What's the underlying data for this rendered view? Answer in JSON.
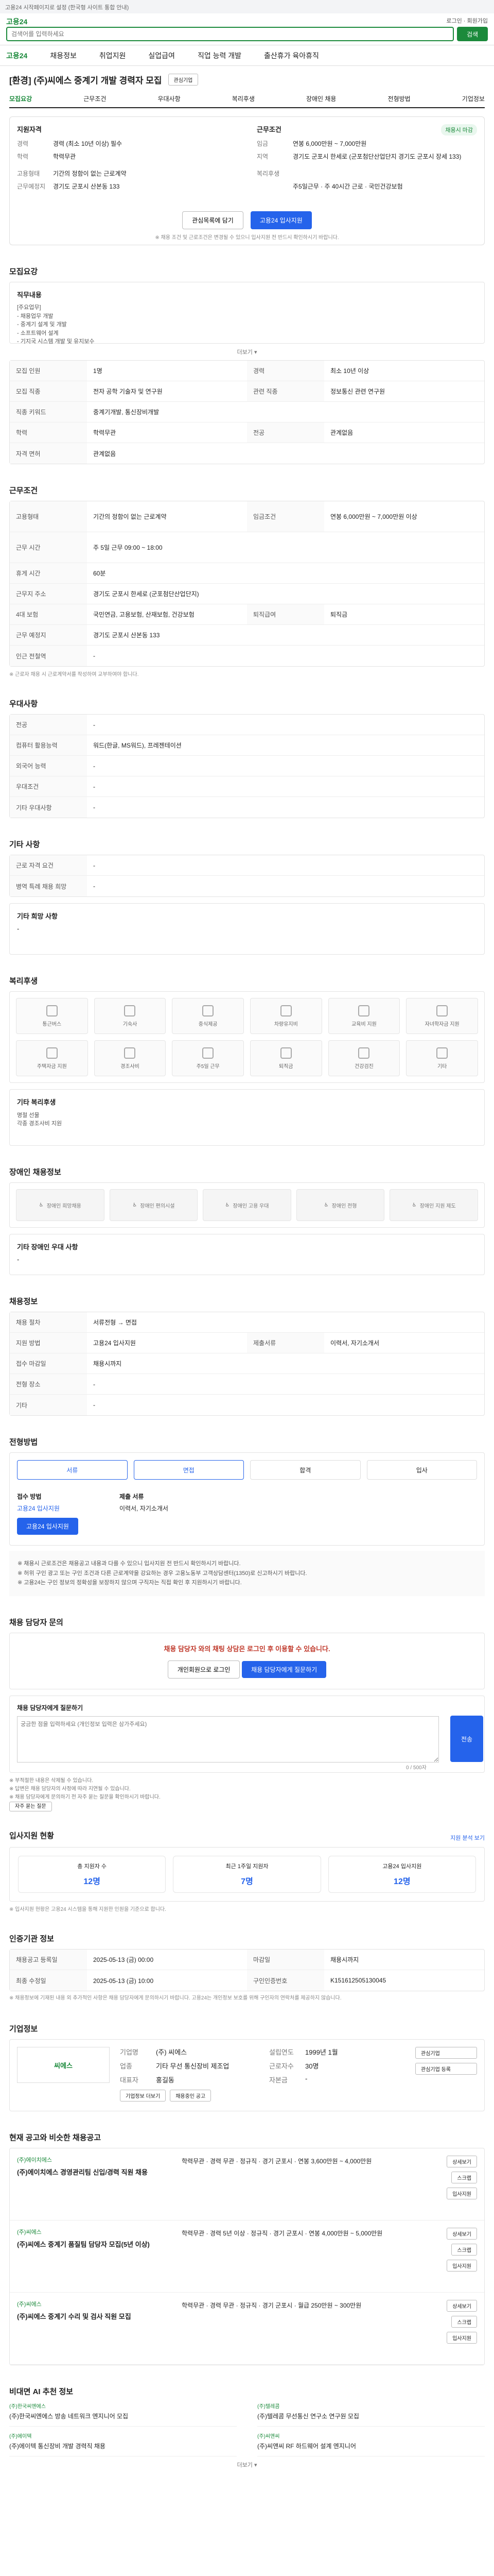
{
  "topbar": {
    "text": "고용24 시작페이지로 설정 (한국형 사이트 통합 안내)"
  },
  "header": {
    "logo": "고용24",
    "search_placeholder": "검색어를 입력하세요",
    "search_btn": "검색",
    "right_links": "로그인 · 회원가입"
  },
  "nav": [
    "고용24",
    "채용정보",
    "취업지원",
    "실업급여",
    "직업 능력 개발",
    "출산휴가 육아휴직"
  ],
  "title": "[환경] (주)씨에스 중계기 개발 경력자 모집",
  "interest_btn": "관심기업",
  "tabs": [
    "모집요강",
    "근무조건",
    "우대사항",
    "복리후생",
    "장애인 채용",
    "전형방법",
    "기업정보"
  ],
  "summary": {
    "left_title": "지원자격",
    "left": [
      {
        "k": "경력",
        "v": "경력 (최소 10년 이상) 필수"
      },
      {
        "k": "학력",
        "v": "학력무관"
      },
      {
        "k": "",
        "v": ""
      },
      {
        "k": "고용형태",
        "v": "기간의 정함이 없는 근로계약"
      },
      {
        "k": "근무예정지",
        "v": "경기도 군포시 산본동 133"
      }
    ],
    "right_title": "근무조건",
    "right": [
      {
        "k": "임금",
        "v": "연봉 6,000만원 ~ 7,000만원"
      },
      {
        "k": "지역",
        "v": "경기도 군포시 한세로 (군포첨단산업단지 경기도 군포시 장세 133)"
      },
      {
        "k": "",
        "v": ""
      },
      {
        "k": "복리후생",
        "v": ""
      },
      {
        "k": "",
        "v": "주5일근무 · 주 40시간 근로 · 국민건강보험"
      }
    ],
    "closed_badge": "채용시 마감",
    "btn_interest": "관심목록에 담기",
    "btn_apply": "고용24 입사지원",
    "note": "※ 채용 조건 및 근로조건은 변경될 수 있으니 입사지원 전 반드시 확인하시기 바랍니다."
  },
  "recruit": {
    "title": "모집요강",
    "duty_label": "직무내용",
    "duty_text": "[주요업무]\n- 채용업무 개발\n- 중계기 설계 및 개발\n- 소프트웨어 설계\n- 기지국 시스템 개발 및 유지보수",
    "more_btn": "더보기 ▾",
    "rows": [
      {
        "k": "모집 인원",
        "v": "1명",
        "k2": "경력",
        "v2": "최소 10년 이상"
      },
      {
        "k": "모집 직종",
        "v": "전자 공학 기술자 및 연구원",
        "k2": "관련 직종",
        "v2": "정보통신 관련 연구원"
      },
      {
        "k": "직종 키워드",
        "v": "중계기개발, 통신장비개발"
      },
      {
        "k": "학력",
        "v": "학력무관",
        "k2": "전공",
        "v2": "관계없음"
      },
      {
        "k": "자격 면허",
        "v": "관계없음"
      }
    ]
  },
  "conditions": {
    "title": "근무조건",
    "rows": [
      {
        "k": "고용형태",
        "v": "기간의 정함이 없는 근로계약",
        "k2": "임금조건",
        "v2": "연봉 6,000만원 ~ 7,000만원 이상"
      },
      {
        "k": "근무 시간",
        "v": "주 5일 근무 09:00 ~ 18:00"
      },
      {
        "k": "휴게 시간",
        "v": "60분"
      },
      {
        "k": "근무지 주소",
        "v": "경기도 군포시 한세로 (군포첨단산업단지)"
      },
      {
        "k": "4대 보험",
        "v": "국민연금, 고용보험, 산재보험, 건강보험",
        "k2": "퇴직급여",
        "v2": "퇴직금"
      },
      {
        "k": "근무 예정지",
        "v": "경기도 군포시 산본동 133"
      },
      {
        "k": "인근 전철역",
        "v": "-"
      }
    ],
    "note": "※ 근로자 채용 시 근로계약서를 작성하여 교부하여야 합니다."
  },
  "prefer": {
    "title": "우대사항",
    "rows": [
      {
        "k": "전공",
        "v": "-"
      },
      {
        "k": "컴퓨터 활용능력",
        "v": "워드(한글, MS워드), 프레젠테이션"
      },
      {
        "k": "외국어 능력",
        "v": "-"
      },
      {
        "k": "우대조건",
        "v": "-"
      },
      {
        "k": "기타 우대사항",
        "v": "-"
      }
    ]
  },
  "vacancy": {
    "title": "기타 사항",
    "rows": [
      {
        "k": "근로 자격 요건",
        "v": "-"
      },
      {
        "k": "병역 특례 채용 희망",
        "v": "-"
      }
    ],
    "extra_label": "기타 희망 사항",
    "extra_value": "-"
  },
  "welfare": {
    "title": "복리후생",
    "items": [
      "통근버스",
      "기숙사",
      "중식제공",
      "차량유지비",
      "교육비 지원",
      "자녀학자금 지원",
      "주택자금 지원",
      "경조사비",
      "주5일 근무",
      "퇴직금",
      "건강검진",
      "기타"
    ],
    "etc_label": "기타 복리후생",
    "etc_text": "명절 선물\n각종 경조사비 지원\n"
  },
  "disability": {
    "title": "장애인 채용정보",
    "items": [
      "장애인 희망채용",
      "장애인 편의시설",
      "장애인 고용 우대",
      "장애인 전형",
      "장애인 지원 제도"
    ],
    "note_label": "기타 장애인 우대 사항",
    "note_value": "-"
  },
  "consult": {
    "title": "채용정보",
    "rows": [
      {
        "k": "채용 절차",
        "v": "서류전형 → 면접",
        "k2": "",
        "v2": ""
      },
      {
        "k": "지원 방법",
        "v": "고용24 입사지원",
        "k2": "제출서류",
        "v2": "이력서, 자기소개서"
      },
      {
        "k": "접수 마감일",
        "v": "채용시까지",
        "k2": "",
        "v2": ""
      },
      {
        "k": "전형 장소",
        "v": "-",
        "k2": "",
        "v2": ""
      },
      {
        "k": "기타",
        "v": "-",
        "k2": "",
        "v2": ""
      }
    ]
  },
  "process": {
    "title": "전형방법",
    "steps": [
      "서류",
      "면접",
      "합격",
      "입사"
    ],
    "apply_label": "접수 방법",
    "apply_value": "고용24 입사지원",
    "btn_apply": "고용24 입사지원",
    "docs_label": "제출 서류",
    "docs_value": "이력서, 자기소개서",
    "warn": "※ 채용시 근로조건은 채용공고 내용과 다를 수 있으니 입사지원 전 반드시 확인하시기 바랍니다.\n※ 허위 구인 광고 또는 구인 조건과 다른 근로계약을 강요하는 경우 고용노동부 고객상담센터(1350)로 신고하시기 바랍니다.\n※ 고용24는 구인 정보의 정확성을 보장하지 않으며 구직자는 직접 확인 후 지원하시기 바랍니다."
  },
  "qna": {
    "title": "채용 담당자 문의",
    "notice": "채용 담당자 와의 채팅 상담은 로그인 후 이용할 수 있습니다.",
    "btn_login": "개인회원으로 로그인",
    "btn_ask": "채용 담당자에게 질문하기",
    "input_label": "채용 담당자에게 질문하기",
    "placeholder": "궁금한 점을 입력하세요 (개인정보 입력은 삼가주세요)",
    "count": "0 / 500자",
    "btn_send": "전송",
    "notes": "※ 부적절한 내용은 삭제될 수 있습니다.\n※ 답변은 채용 담당자의 사정에 따라 지연될 수 있습니다.\n※ 채용 담당자에게 문의하기 전 자주 묻는 질문을 확인하시기 바랍니다.",
    "faq_btn": "자주 묻는 질문"
  },
  "applicants": {
    "title": "입사지원 현황",
    "link": "지원 분석 보기",
    "stats": [
      {
        "label": "총 지원자 수",
        "value": "12명"
      },
      {
        "label": "최근 1주일 지원자",
        "value": "7명"
      },
      {
        "label": "고용24 입사지원",
        "value": "12명"
      }
    ],
    "note": "※ 입사지원 현황은 고용24 시스템을 통해 지원한 인원을 기준으로 합니다."
  },
  "reginfo": {
    "title": "인증기관 정보",
    "rows": [
      {
        "k": "채용공고 등록일",
        "v": "2025-05-13 (금) 00:00",
        "k2": "마감일",
        "v2": "채용시까지"
      },
      {
        "k": "최종 수정일",
        "v": "2025-05-13 (금) 10:00",
        "k2": "구인인증번호",
        "v2": "K151612505130045"
      }
    ],
    "note": "※ 채용정보에 기재된 내용 외 추가적인 사항은 채용 담당자에게 문의하시기 바랍니다. 고용24는 개인정보 보호를 위해 구인자의 연락처를 제공하지 않습니다."
  },
  "company": {
    "title": "기업정보",
    "logo_text": "씨에스",
    "rows": [
      {
        "k": "기업명",
        "v": "(주) 씨에스",
        "k2": "설립연도",
        "v2": "1999년 1월"
      },
      {
        "k": "업종",
        "v": "기타 무선 통신장비 제조업",
        "k2": "근로자수",
        "v2": "30명"
      },
      {
        "k": "대표자",
        "v": "홍길동",
        "k2": "자본금",
        "v2": "-"
      }
    ],
    "btn_more": "기업정보 더보기",
    "btn_jobs": "채용중인 공고",
    "btn_interest": "관심기업",
    "btn_follow": "관심기업 등록"
  },
  "similar": {
    "title": "현재 공고와 비슷한 채용공고",
    "items": [
      {
        "company": "(주)에이치에스",
        "title": "(주)에이치에스 경영관리팀 신입/경력 직원 채용",
        "info": "학력무관 · 경력 무관 · 정규직 · 경기 군포시 · 연봉 3,600만원 ~ 4,000만원"
      },
      {
        "company": "(주)씨에스",
        "title": "(주)씨에스 중계기 품질팀 담당자 모집(5년 이상)",
        "info": "학력무관 · 경력 5년 이상 · 정규직 · 경기 군포시 · 연봉 4,000만원 ~ 5,000만원"
      },
      {
        "company": "(주)씨에스",
        "title": "(주)씨에스 중계기 수리 및 검사 직원 모집",
        "info": "학력무관 · 경력 무관 · 정규직 · 경기 군포시 · 월급 250만원 ~ 300만원"
      }
    ],
    "btn_view": "상세보기",
    "btn_scrap": "스크랩",
    "btn_apply": "입사지원"
  },
  "ai": {
    "title": "비대면 AI 추천 정보",
    "items": [
      {
        "company": "(주)한국씨엔에스",
        "title": "(주)한국씨엔에스 방송 네트워크 엔지니어 모집"
      },
      {
        "company": "(주)텔레콤",
        "title": "(주)텔레콤 무선통신 연구소 연구원 모집"
      },
      {
        "company": "(주)에이텍",
        "title": "(주)에이텍 통신장비 개발 경력직 채용"
      },
      {
        "company": "(주)씨앤씨",
        "title": "(주)씨앤씨 RF 하드웨어 설계 엔지니어"
      }
    ],
    "more": "더보기 ▾"
  }
}
